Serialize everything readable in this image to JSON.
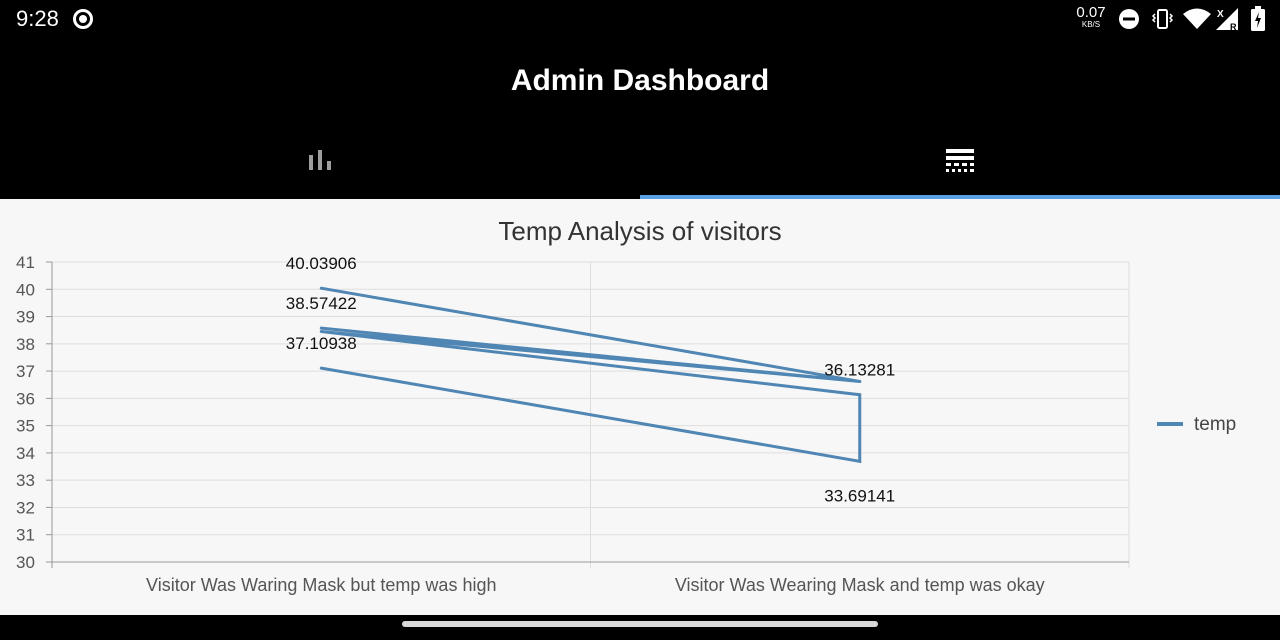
{
  "status_bar": {
    "time": "9:28",
    "net_speed_value": "0.07",
    "net_speed_unit": "KB/S",
    "icons": [
      "record-icon",
      "do-not-disturb-icon",
      "vibrate-icon",
      "wifi-icon",
      "cell-signal-icon",
      "battery-icon"
    ]
  },
  "app_bar": {
    "title": "Admin Dashboard"
  },
  "tabs": [
    {
      "icon": "bar-chart-icon",
      "selected": false
    },
    {
      "icon": "table-chart-icon",
      "selected": true
    }
  ],
  "colors": {
    "series": "#4f86b4",
    "tab_indicator": "#5aa0e6",
    "chart_background": "#f7f7f7"
  },
  "chart_data": {
    "type": "line",
    "title": "Temp Analysis of visitors",
    "categories": [
      "Visitor Was Waring Mask but temp was high",
      "Visitor Was Wearing Mask and temp was okay"
    ],
    "ylim": [
      30,
      41
    ],
    "yticks": [
      30,
      31,
      32,
      33,
      34,
      35,
      36,
      37,
      38,
      39,
      40,
      41
    ],
    "grid": true,
    "legend_position": "right",
    "series": [
      {
        "name": "temp",
        "points": [
          {
            "category": 0,
            "value": 40.03906,
            "label": "40.03906"
          },
          {
            "category": 1,
            "value": 36.62,
            "label": ""
          },
          {
            "category": 0,
            "value": 38.57422,
            "label": "38.57422"
          },
          {
            "category": 1,
            "value": 36.62,
            "label": ""
          },
          {
            "category": 0,
            "value": 38.45,
            "label": ""
          },
          {
            "category": 1,
            "value": 36.13281,
            "label": "36.13281"
          },
          {
            "category": 1,
            "value": 33.69141,
            "label": "33.69141"
          },
          {
            "category": 0,
            "value": 37.10938,
            "label": "37.10938"
          }
        ]
      }
    ]
  }
}
